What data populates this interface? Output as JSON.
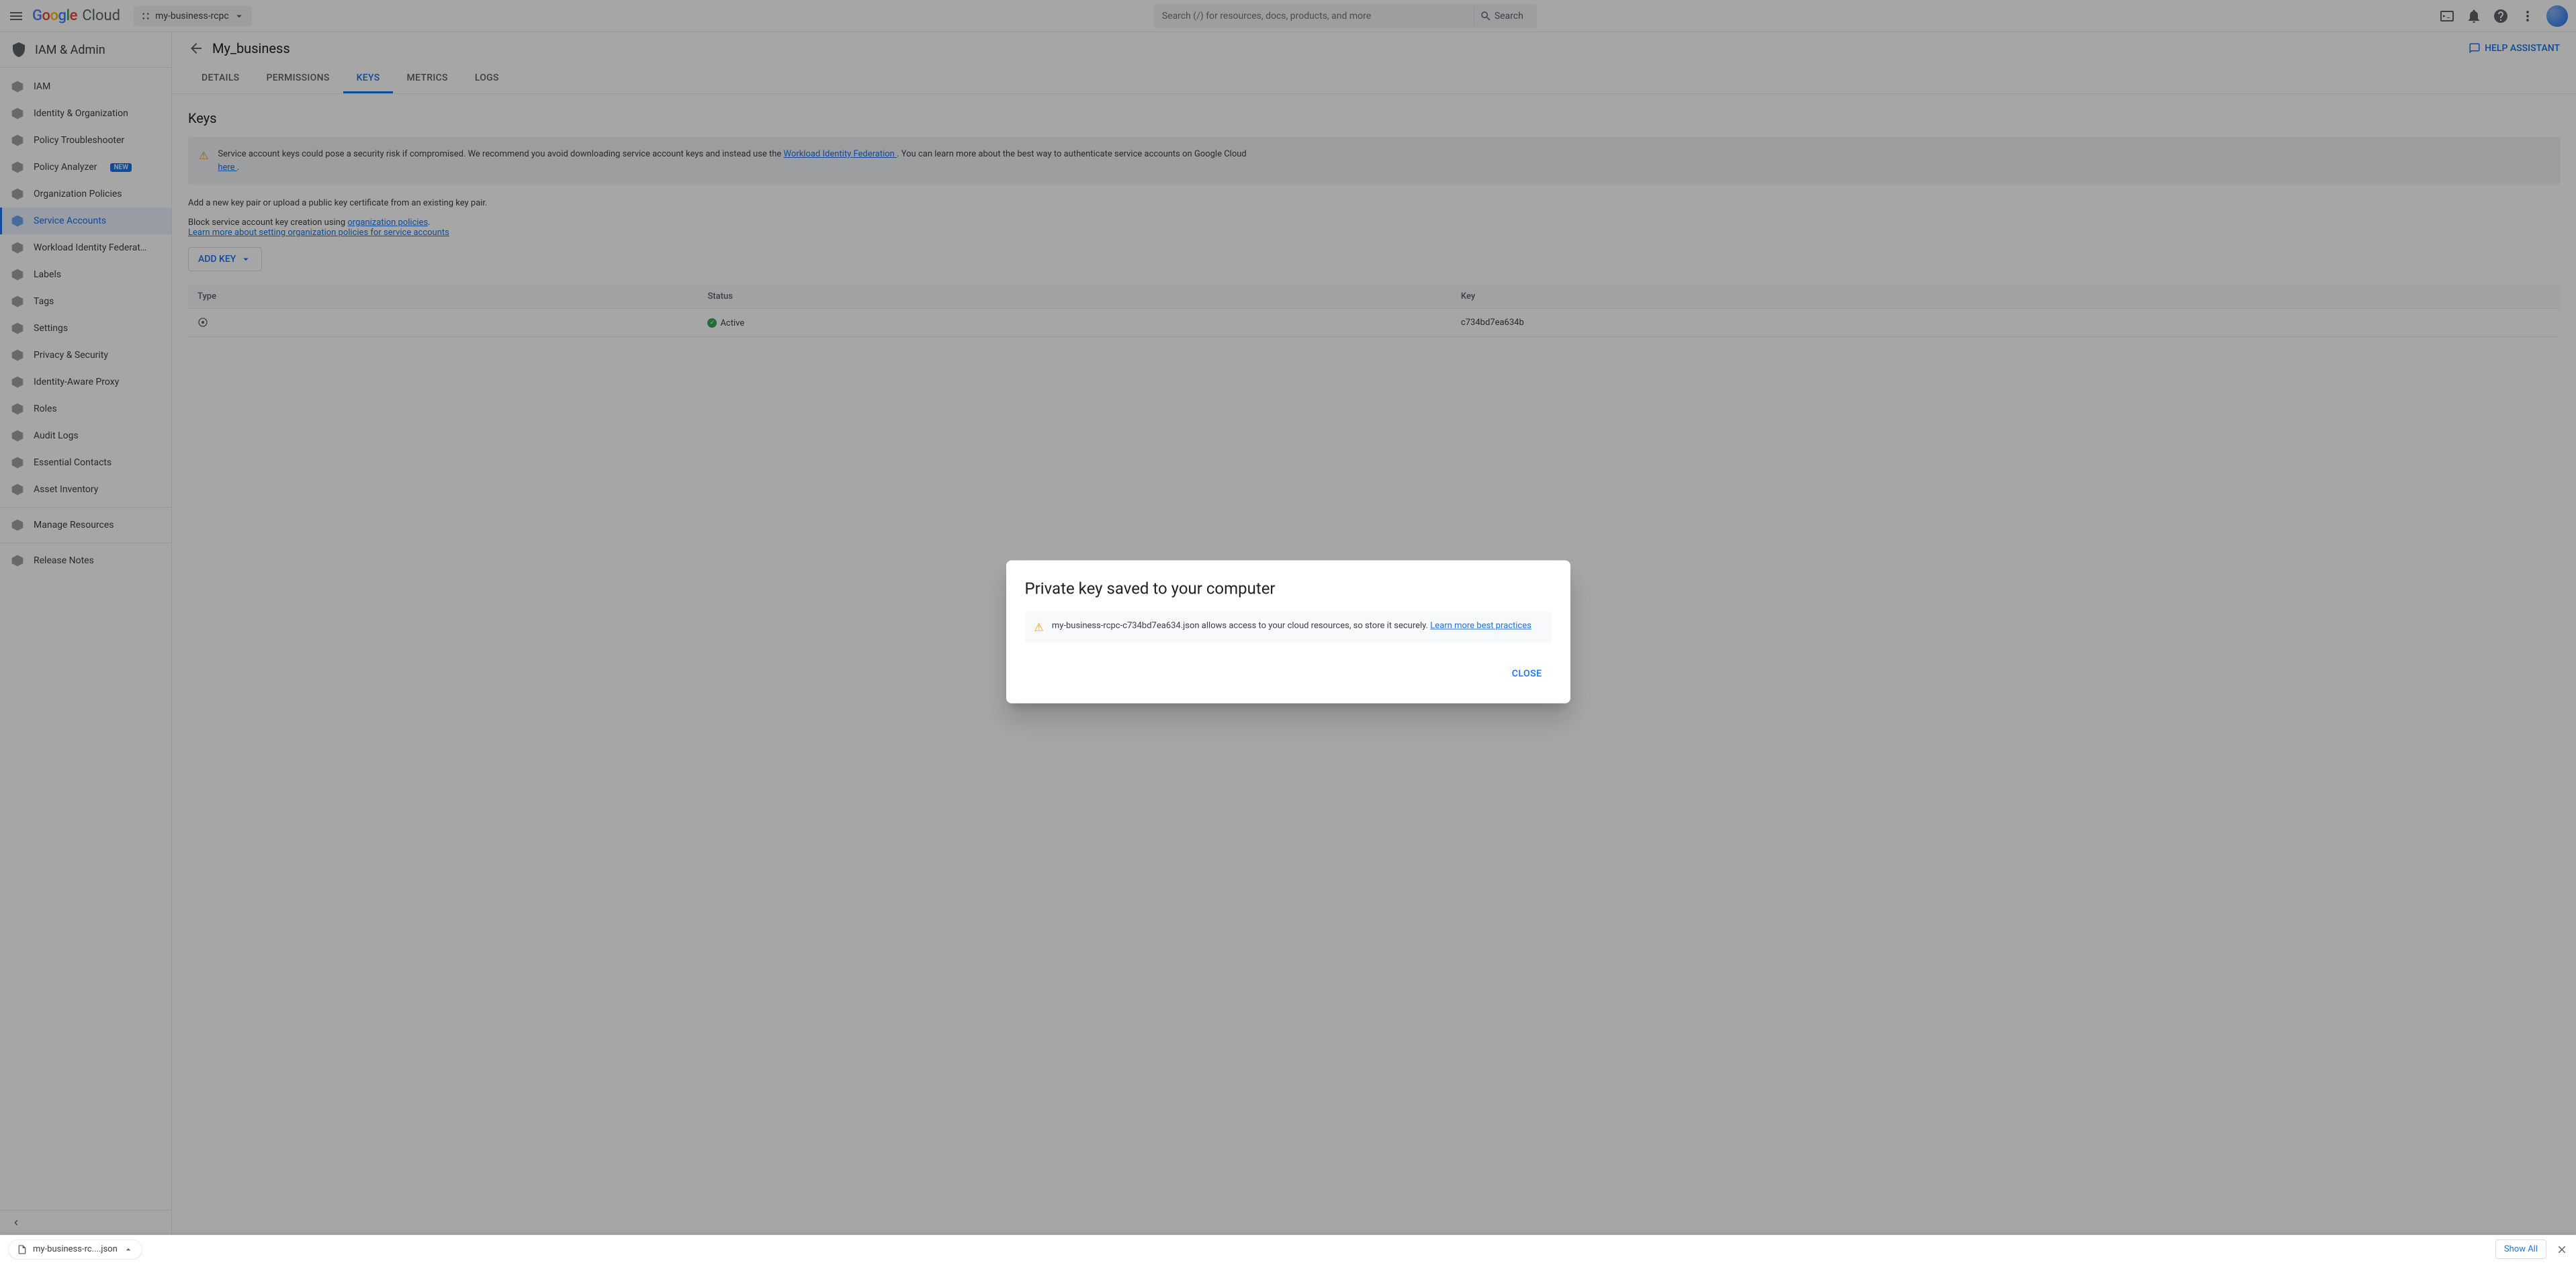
{
  "header": {
    "project": "my-business-rcpc",
    "searchPlaceholder": "Search (/) for resources, docs, products, and more",
    "searchButton": "Search"
  },
  "product": {
    "title": "IAM & Admin"
  },
  "sidebar": {
    "items": [
      {
        "label": "IAM",
        "icon": "person-add"
      },
      {
        "label": "Identity & Organization",
        "icon": "circle-user"
      },
      {
        "label": "Policy Troubleshooter",
        "icon": "wrench"
      },
      {
        "label": "Policy Analyzer",
        "icon": "analyze",
        "badge": "NEW"
      },
      {
        "label": "Organization Policies",
        "icon": "list"
      },
      {
        "label": "Service Accounts",
        "icon": "service",
        "active": true
      },
      {
        "label": "Workload Identity Federat…",
        "icon": "federation"
      },
      {
        "label": "Labels",
        "icon": "label"
      },
      {
        "label": "Tags",
        "icon": "tag"
      },
      {
        "label": "Settings",
        "icon": "gear"
      },
      {
        "label": "Privacy & Security",
        "icon": "lock"
      },
      {
        "label": "Identity-Aware Proxy",
        "icon": "proxy"
      },
      {
        "label": "Roles",
        "icon": "roles"
      },
      {
        "label": "Audit Logs",
        "icon": "logs"
      },
      {
        "label": "Essential Contacts",
        "icon": "contacts"
      },
      {
        "label": "Asset Inventory",
        "icon": "asset"
      }
    ],
    "footer": [
      {
        "label": "Manage Resources",
        "icon": "manage"
      },
      {
        "label": "Release Notes",
        "icon": "notes"
      }
    ]
  },
  "page": {
    "title": "My_business",
    "helpAssistant": "HELP ASSISTANT",
    "tabs": [
      "DETAILS",
      "PERMISSIONS",
      "KEYS",
      "METRICS",
      "LOGS"
    ],
    "activeTab": 2,
    "sectionTitle": "Keys",
    "warning": {
      "text1": "Service account keys could pose a security risk if compromised. We recommend you avoid downloading service account keys and instead use the ",
      "link1": "Workload Identity Federation ",
      "text2": ". You can learn more about the best way to authenticate service accounts on Google Cloud ",
      "link2": "here ",
      "text3": "."
    },
    "instruction": "Add a new key pair or upload a public key certificate from an existing key pair.",
    "block": {
      "text1": "Block service account key creation using ",
      "link1": "organization policies",
      "text2": ".",
      "link2": "Learn more about setting organization policies for service accounts"
    },
    "addKey": "ADD KEY",
    "table": {
      "headers": [
        "Type",
        "Status",
        "Key"
      ],
      "row": {
        "status": "Active",
        "key": "c734bd7ea634b"
      }
    }
  },
  "modal": {
    "title": "Private key saved to your computer",
    "warnText": "my-business-rcpc-c734bd7ea634.json allows access to your cloud resources, so store it securely. ",
    "warnLink": "Learn more best practices",
    "close": "CLOSE"
  },
  "downloadBar": {
    "filename": "my-business-rc....json",
    "showAll": "Show All"
  }
}
